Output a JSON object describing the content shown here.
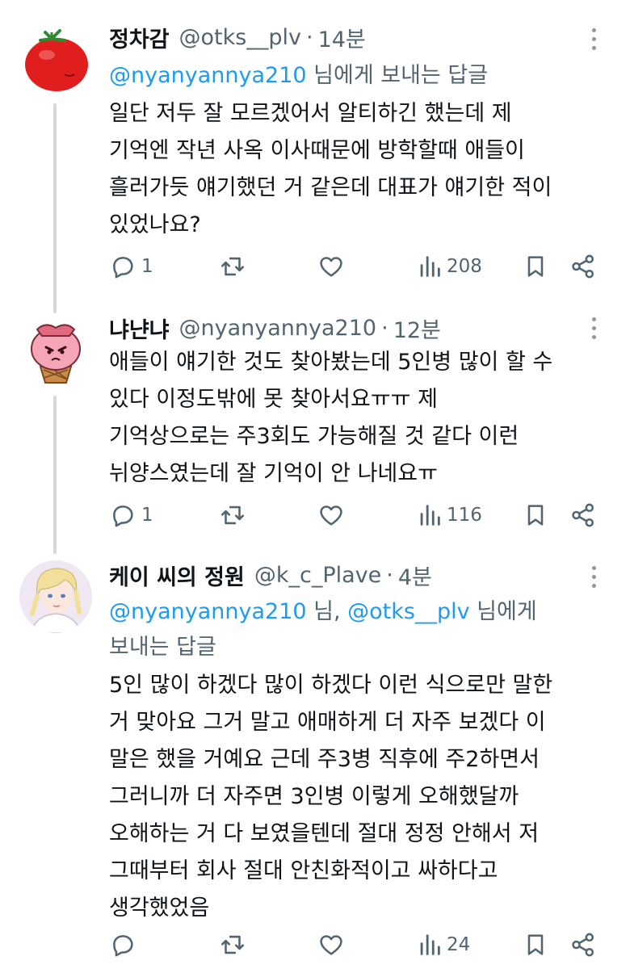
{
  "tweets": [
    {
      "name": "정차감",
      "handle": "@otks__plv",
      "dot": "·",
      "time": "14분",
      "reply_prefix": "",
      "reply_mention": "@nyanyannya210",
      "reply_suffix": " 님에게 보내는 답글",
      "text": "일단 저두 잘 모르겠어서 알티하긴 했는데 제\n기억엔 작년 사옥 이사때문에 방학할때 애들이\n흘러가듯 얘기했던 거 같은데 대표가 얘기한 적이\n있었나요?",
      "replies": "1",
      "retweets": "",
      "likes": "",
      "views": "208",
      "avatar_icon": "tomato-avatar-icon"
    },
    {
      "name": "냐냔냐",
      "handle": "@nyanyannya210",
      "dot": "·",
      "time": "12분",
      "text": "애들이 얘기한 것도 찾아봤는데 5인병 많이 할 수\n있다 이정도밖에 못 찾아서요ㅠㅠ 제\n기억상으로는 주3회도 가능해질 것 같다 이런\n뉘양스였는데 잘 기억이 안 나네요ㅠ",
      "replies": "1",
      "retweets": "",
      "likes": "",
      "views": "116",
      "avatar_icon": "pink-character-avatar-icon"
    },
    {
      "name": "케이 씨의 정원",
      "handle": "@k_c_Plave",
      "dot": "·",
      "time": "4분",
      "reply_mention1": "@nyanyannya210",
      "reply_mid": " 님, ",
      "reply_mention2": "@otks__plv",
      "reply_suffix": " 님에게",
      "reply_line2": "보내는 답글",
      "text": "5인 많이 하겠다 많이 하겠다 이런 식으로만 말한\n거 맞아요 그거 말고 애매하게 더 자주 보겠다 이\n말은 했을 거예요 근데 주3병 직후에 주2하면서\n그러니까 더 자주면 3인병 이렇게 오해했달까\n오해하는 거 다 보였을텐데 절대 정정 안해서 저\n그때부터 회사 절대 안친화적이고 싸하다고\n생각했었음",
      "replies": "",
      "retweets": "",
      "likes": "",
      "views": "24",
      "avatar_icon": "anime-character-avatar-icon"
    }
  ],
  "icons": {
    "reply": "reply-icon",
    "retweet": "retweet-icon",
    "like": "heart-icon",
    "views": "views-icon",
    "bookmark": "bookmark-icon",
    "share": "share-icon",
    "more": "more-icon"
  },
  "colors": {
    "link": "#1d9bf0",
    "secondary": "#536471",
    "thread_line": "#cfd9de"
  }
}
